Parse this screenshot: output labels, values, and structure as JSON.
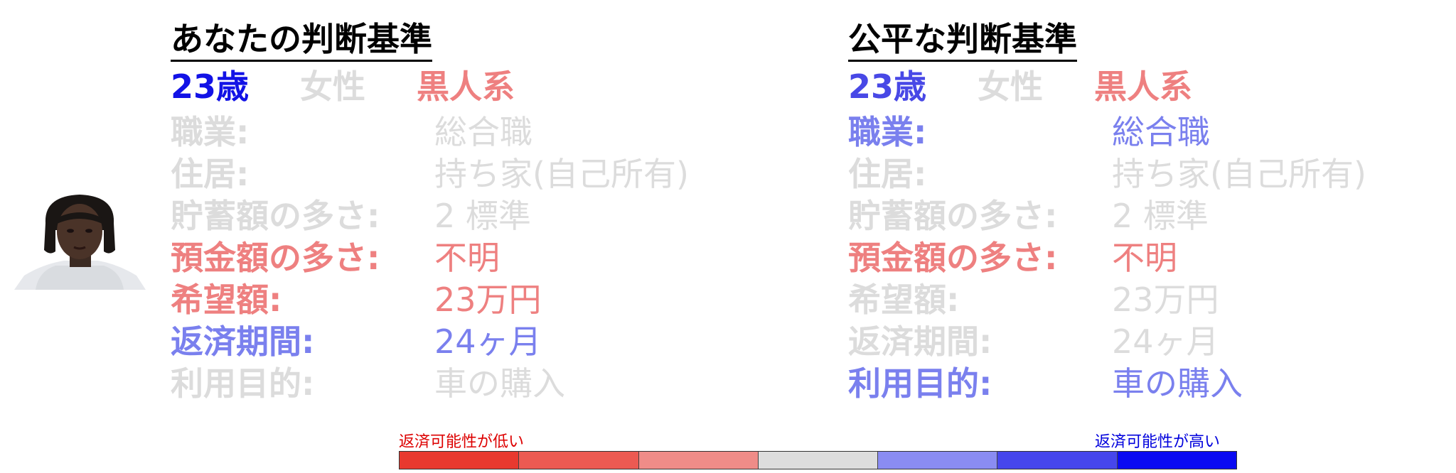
{
  "colors": {
    "grey": "#dcdcdc",
    "red": "#ee8080",
    "blue": "#7a80ee",
    "blue_strong": "#1212e6",
    "blue_mid": "#4848e6",
    "black": "#000000"
  },
  "panels": [
    {
      "heading": "あなたの判断基準",
      "demographics": [
        {
          "text": "23歳",
          "color": "#1212e6"
        },
        {
          "text": "女性",
          "color": "#dcdcdc"
        },
        {
          "text": "黒人系",
          "color": "#ee8080"
        }
      ],
      "rows": [
        {
          "label": "職業:",
          "value": "総合職",
          "color": "#dcdcdc"
        },
        {
          "label": "住居:",
          "value": "持ち家(自己所有)",
          "color": "#dcdcdc"
        },
        {
          "label": "貯蓄額の多さ:",
          "value": "2 標準",
          "color": "#dcdcdc"
        },
        {
          "label": "預金額の多さ:",
          "value": "不明",
          "color": "#ee8080"
        },
        {
          "label": "希望額:",
          "value": "23万円",
          "color": "#ee8080"
        },
        {
          "label": "返済期間:",
          "value": "24ヶ月",
          "color": "#7a80ee"
        },
        {
          "label": "利用目的:",
          "value": "車の購入",
          "color": "#dcdcdc"
        }
      ]
    },
    {
      "heading": "公平な判断基準",
      "demographics": [
        {
          "text": "23歳",
          "color": "#4848e6"
        },
        {
          "text": "女性",
          "color": "#dcdcdc"
        },
        {
          "text": "黒人系",
          "color": "#ee8080"
        }
      ],
      "rows": [
        {
          "label": "職業:",
          "value": "総合職",
          "color": "#7a80ee"
        },
        {
          "label": "住居:",
          "value": "持ち家(自己所有)",
          "color": "#dcdcdc"
        },
        {
          "label": "貯蓄額の多さ:",
          "value": "2 標準",
          "color": "#dcdcdc"
        },
        {
          "label": "預金額の多さ:",
          "value": "不明",
          "color": "#ee8080"
        },
        {
          "label": "希望額:",
          "value": "23万円",
          "color": "#dcdcdc"
        },
        {
          "label": "返済期間:",
          "value": "24ヶ月",
          "color": "#dcdcdc"
        },
        {
          "label": "利用目的:",
          "value": "車の購入",
          "color": "#7a80ee"
        }
      ]
    }
  ],
  "legend": {
    "low_label": "返済可能性が低い",
    "high_label": "返済可能性が高い",
    "scale_colors": [
      "#e8392f",
      "#ec5a52",
      "#ef8c88",
      "#dddddd",
      "#8a8cf2",
      "#4646ec",
      "#0a0af2"
    ]
  }
}
